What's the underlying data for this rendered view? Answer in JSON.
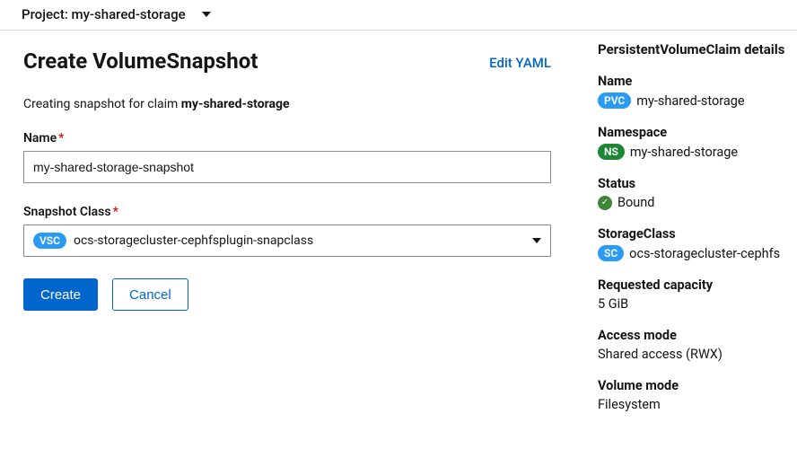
{
  "topbar": {
    "project_prefix": "Project:",
    "project_name": "my-shared-storage"
  },
  "header": {
    "title": "Create VolumeSnapshot",
    "edit_yaml": "Edit YAML"
  },
  "subheader": {
    "prefix": "Creating snapshot for claim ",
    "claim": "my-shared-storage"
  },
  "form": {
    "name_label": "Name",
    "name_value": "my-shared-storage-snapshot",
    "snapclass_label": "Snapshot Class",
    "snapclass_badge": "VSC",
    "snapclass_value": "ocs-storagecluster-cephfsplugin-snapclass"
  },
  "buttons": {
    "create": "Create",
    "cancel": "Cancel"
  },
  "side": {
    "title": "PersistentVolumeClaim details",
    "name_label": "Name",
    "name_badge": "PVC",
    "name_value": "my-shared-storage",
    "ns_label": "Namespace",
    "ns_badge": "NS",
    "ns_value": "my-shared-storage",
    "status_label": "Status",
    "status_value": "Bound",
    "sc_label": "StorageClass",
    "sc_badge": "SC",
    "sc_value": "ocs-storagecluster-cephfs",
    "cap_label": "Requested capacity",
    "cap_value": "5 GiB",
    "access_label": "Access mode",
    "access_value": "Shared access (RWX)",
    "volmode_label": "Volume mode",
    "volmode_value": "Filesystem"
  }
}
